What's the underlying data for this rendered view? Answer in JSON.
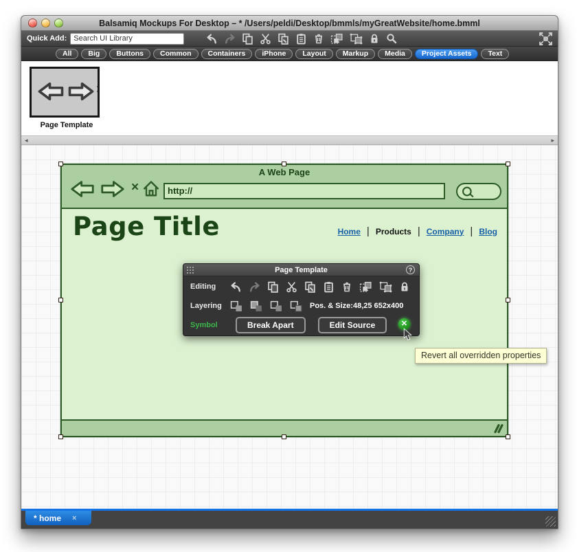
{
  "window": {
    "title": "Balsamiq Mockups For Desktop – * /Users/peldi/Desktop/bmmls/myGreatWebsite/home.bmml",
    "traffic_lights": [
      "close",
      "minimize",
      "zoom"
    ]
  },
  "toolbar": {
    "quick_add_label": "Quick Add:",
    "search_value": "Search UI Library",
    "icons": [
      "undo",
      "redo",
      "copy",
      "cut",
      "paste-special",
      "paste",
      "delete",
      "group",
      "ungroup",
      "lock",
      "zoom"
    ],
    "fullscreen_icon": "fullscreen"
  },
  "tabs": {
    "selected": "Project Assets",
    "items": [
      {
        "label": "All"
      },
      {
        "label": "Big"
      },
      {
        "label": "Buttons"
      },
      {
        "label": "Common"
      },
      {
        "label": "Containers"
      },
      {
        "label": "iPhone"
      },
      {
        "label": "Layout"
      },
      {
        "label": "Markup"
      },
      {
        "label": "Media"
      },
      {
        "label": "Project Assets"
      },
      {
        "label": "Text"
      }
    ]
  },
  "assets": {
    "items": [
      {
        "label": "Page Template"
      }
    ]
  },
  "mockup": {
    "browser_title": "A Web Page",
    "close_glyph": "×",
    "url_value": "http://",
    "page_title": "Page Title",
    "nav_separator": "|",
    "nav": [
      {
        "label": "Home",
        "style": "link"
      },
      {
        "label": "Products",
        "style": "current"
      },
      {
        "label": "Company",
        "style": "link"
      },
      {
        "label": "Blog",
        "style": "link"
      }
    ],
    "selection": {
      "handles": 8,
      "pos": "48,25",
      "size": "652x400"
    }
  },
  "inspector": {
    "title": "Page Template",
    "help_glyph": "?",
    "editing_label": "Editing",
    "editing_icons": [
      "undo",
      "redo",
      "copy",
      "cut",
      "paste-special",
      "paste",
      "delete",
      "group",
      "ungroup",
      "lock"
    ],
    "layering_label": "Layering",
    "layering_icons": [
      "bring-to-front",
      "bring-forward",
      "send-backward",
      "send-to-back"
    ],
    "pos_size_text": "Pos. & Size:48,25 652x400",
    "symbol_label": "Symbol",
    "break_apart_label": "Break Apart",
    "edit_source_label": "Edit Source",
    "revert_glyph": "✕"
  },
  "tooltip": {
    "text": "Revert all overridden properties"
  },
  "scrollbar": {
    "left_arrow": "◂",
    "right_arrow": "▸"
  },
  "footer": {
    "tabs": [
      {
        "label": "* home",
        "close_glyph": "×",
        "active": true
      }
    ]
  },
  "colors": {
    "accent_blue": "#1473e6",
    "selected_pill_blue": "#1767cd",
    "symbol_green": "#3cb54a",
    "revert_green": "#22961f",
    "mockup_border_green": "#2d5a27",
    "mockup_fill_light": "#dcf1d0",
    "mockup_fill_medium": "#abcfa0",
    "tooltip_yellow": "#ffffd6",
    "link_blue": "#1660a8"
  }
}
